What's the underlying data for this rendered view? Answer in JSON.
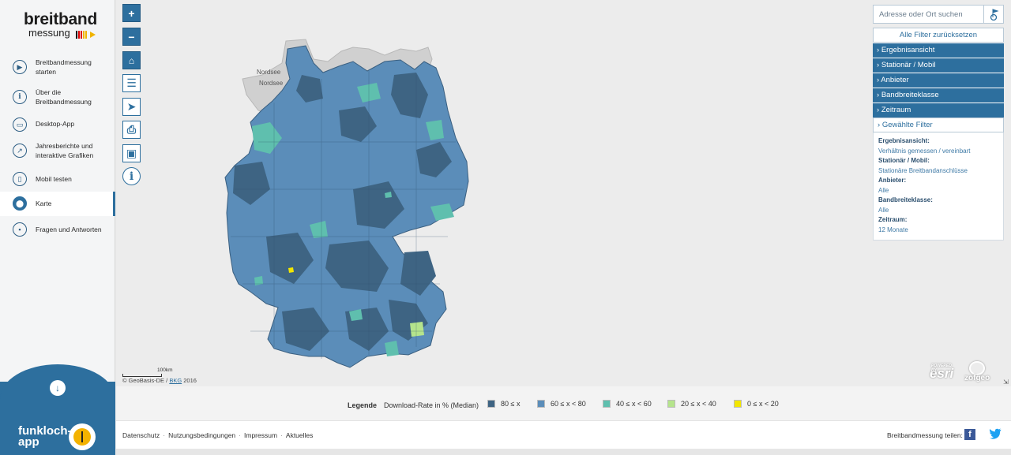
{
  "logo": {
    "line1": "breitband",
    "line2": "messung"
  },
  "sidebar": {
    "items": [
      {
        "label": "Breitbandmessung starten",
        "icon": "play-icon"
      },
      {
        "label": "Über die Breitbandmessung",
        "icon": "info-icon"
      },
      {
        "label": "Desktop-App",
        "icon": "monitor-icon"
      },
      {
        "label": "Jahresberichte und interaktive Grafiken",
        "icon": "chart-icon"
      },
      {
        "label": "Mobil testen",
        "icon": "phone-icon"
      },
      {
        "label": "Karte",
        "icon": "map-pin-icon",
        "active": true
      },
      {
        "label": "Fragen und Antworten",
        "icon": "chat-icon"
      }
    ],
    "funkloch": {
      "title": "funkloch-app"
    }
  },
  "map": {
    "labels": {
      "nordsee1": "Nordsee",
      "nordsee2": "Nordsee"
    },
    "scale_label": "100km",
    "attribution": {
      "prefix": "© GeoBasis-DE /",
      "link": "BKG",
      "year": "2016"
    },
    "esri": "esri",
    "esri_small": "POWERED BY",
    "zofgeo": "zofgeo"
  },
  "search": {
    "placeholder": "Adresse oder Ort suchen"
  },
  "filters": {
    "reset": "Alle Filter zurücksetzen",
    "items": [
      "Ergebnisansicht",
      "Stationär / Mobil",
      "Anbieter",
      "Bandbreiteklasse",
      "Zeitraum"
    ],
    "selected_title": "Gewählte Filter",
    "selected": [
      {
        "key": "Ergebnisansicht:",
        "value": "Verhältnis gemessen / vereinbart"
      },
      {
        "key": "Stationär / Mobil:",
        "value": "Stationäre Breitbandanschlüsse"
      },
      {
        "key": "Anbieter:",
        "value": "Alle"
      },
      {
        "key": "Bandbreiteklasse:",
        "value": "Alle"
      },
      {
        "key": "Zeitraum:",
        "value": "12 Monate"
      }
    ]
  },
  "legend": {
    "title": "Legende",
    "subtitle": "Download-Rate in % (Median)",
    "items": [
      {
        "label": "80 ≤ x",
        "color": "#3e6483"
      },
      {
        "label": "60 ≤ x < 80",
        "color": "#5b8db9"
      },
      {
        "label": "40 ≤ x < 60",
        "color": "#5fbfae"
      },
      {
        "label": "20 ≤ x < 40",
        "color": "#b5e48c"
      },
      {
        "label": "0 ≤ x < 20",
        "color": "#f2e600"
      }
    ]
  },
  "footer": {
    "links": [
      "Datenschutz",
      "Nutzungsbedingungen",
      "Impressum",
      "Aktuelles"
    ],
    "share": "Breitbandmessung teilen:",
    "facebook": "f"
  }
}
